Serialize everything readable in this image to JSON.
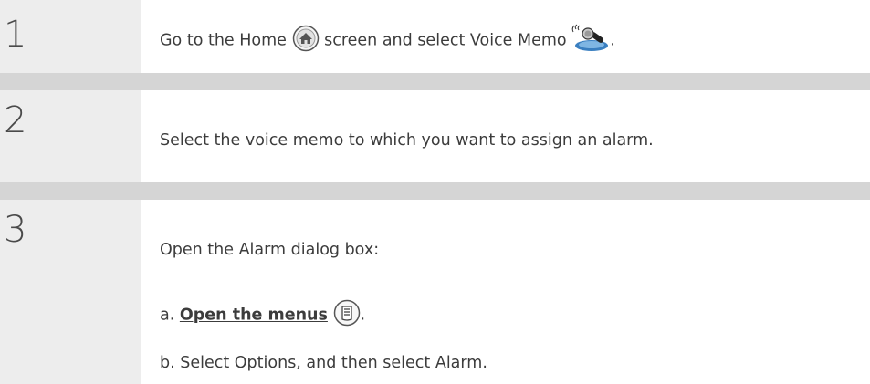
{
  "steps": [
    {
      "number": "1",
      "text_before": "Go to the Home",
      "home_icon": "home-button-icon",
      "text_middle": "screen and select Voice Memo",
      "app_icon": "voice-memo-microphone-icon",
      "text_after": "."
    },
    {
      "number": "2",
      "text": "Select the voice memo to which you want to assign an alarm."
    },
    {
      "number": "3",
      "intro": "Open the Alarm dialog box:",
      "sub_a_prefix": "a.",
      "sub_a_link": "Open the menus",
      "sub_a_icon": "menu-button-icon",
      "sub_a_suffix": ".",
      "sub_b": "b. Select Options, and then select Alarm."
    }
  ],
  "colors": {
    "number_column": "#ededed",
    "separator": "#d5d5d5",
    "text": "#3c3c3c"
  }
}
